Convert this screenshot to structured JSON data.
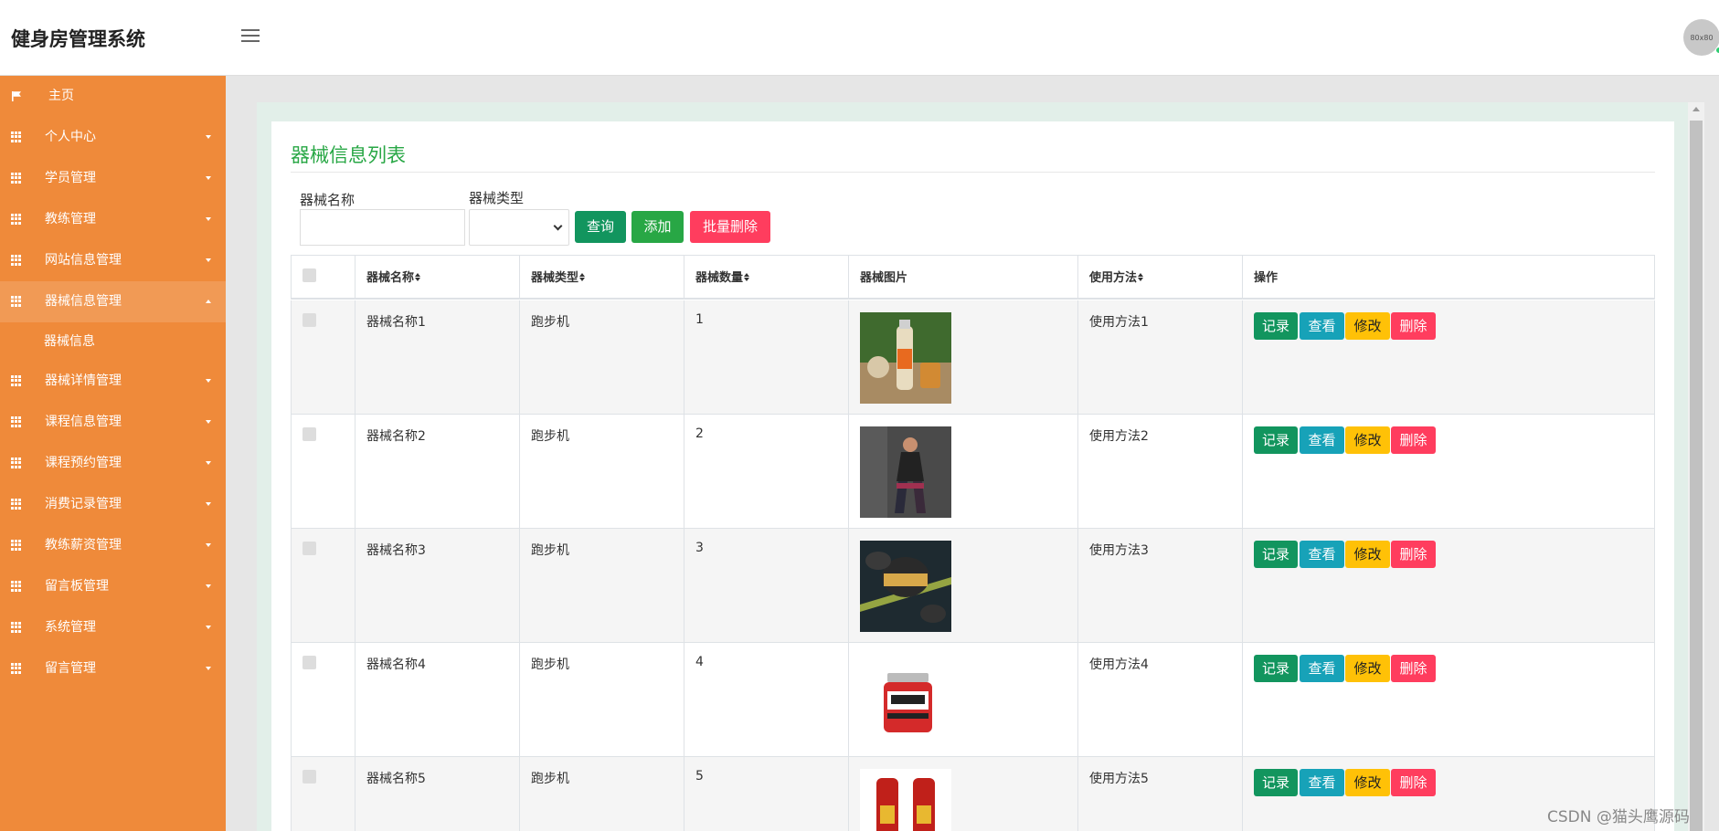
{
  "app": {
    "title": "健身房管理系统",
    "avatar_text": "80x80"
  },
  "sidebar": {
    "items": [
      {
        "label": "主页",
        "icon": "flag-icon"
      },
      {
        "label": "个人中心",
        "icon": "grid-icon"
      },
      {
        "label": "学员管理",
        "icon": "grid-icon"
      },
      {
        "label": "教练管理",
        "icon": "grid-icon"
      },
      {
        "label": "网站信息管理",
        "icon": "grid-icon"
      },
      {
        "label": "器械信息管理",
        "icon": "grid-icon",
        "expanded": true
      },
      {
        "label": "器械详情管理",
        "icon": "grid-icon"
      },
      {
        "label": "课程信息管理",
        "icon": "grid-icon"
      },
      {
        "label": "课程预约管理",
        "icon": "grid-icon"
      },
      {
        "label": "消费记录管理",
        "icon": "grid-icon"
      },
      {
        "label": "教练薪资管理",
        "icon": "grid-icon"
      },
      {
        "label": "留言板管理",
        "icon": "grid-icon"
      },
      {
        "label": "系统管理",
        "icon": "grid-icon"
      },
      {
        "label": "留言管理",
        "icon": "grid-icon"
      }
    ],
    "subitem": "器械信息"
  },
  "main": {
    "title": "器械信息列表",
    "filters": {
      "name_label": "器械名称",
      "name_value": "",
      "type_label": "器械类型",
      "type_value": ""
    },
    "buttons": {
      "search": "查询",
      "add": "添加",
      "batch_delete": "批量删除"
    },
    "table": {
      "headers": [
        "器械名称",
        "器械类型",
        "器械数量",
        "器械图片",
        "使用方法",
        "操作"
      ],
      "rows": [
        {
          "name": "器械名称1",
          "type": "跑步机",
          "qty": "1",
          "method": "使用方法1"
        },
        {
          "name": "器械名称2",
          "type": "跑步机",
          "qty": "2",
          "method": "使用方法2"
        },
        {
          "name": "器械名称3",
          "type": "跑步机",
          "qty": "3",
          "method": "使用方法3"
        },
        {
          "name": "器械名称4",
          "type": "跑步机",
          "qty": "4",
          "method": "使用方法4"
        },
        {
          "name": "器械名称5",
          "type": "跑步机",
          "qty": "5",
          "method": "使用方法5"
        }
      ],
      "actions": {
        "record": "记录",
        "view": "查看",
        "edit": "修改",
        "delete": "删除"
      }
    }
  },
  "colors": {
    "sidebar": "#ef8a3a",
    "title_green": "#28a745",
    "btn_teal": "#17a2b8",
    "btn_yellow": "#ffc107",
    "btn_red": "#ff3d5e",
    "btn_green": "#12955e"
  },
  "watermark": "CSDN @猫头鹰源码"
}
